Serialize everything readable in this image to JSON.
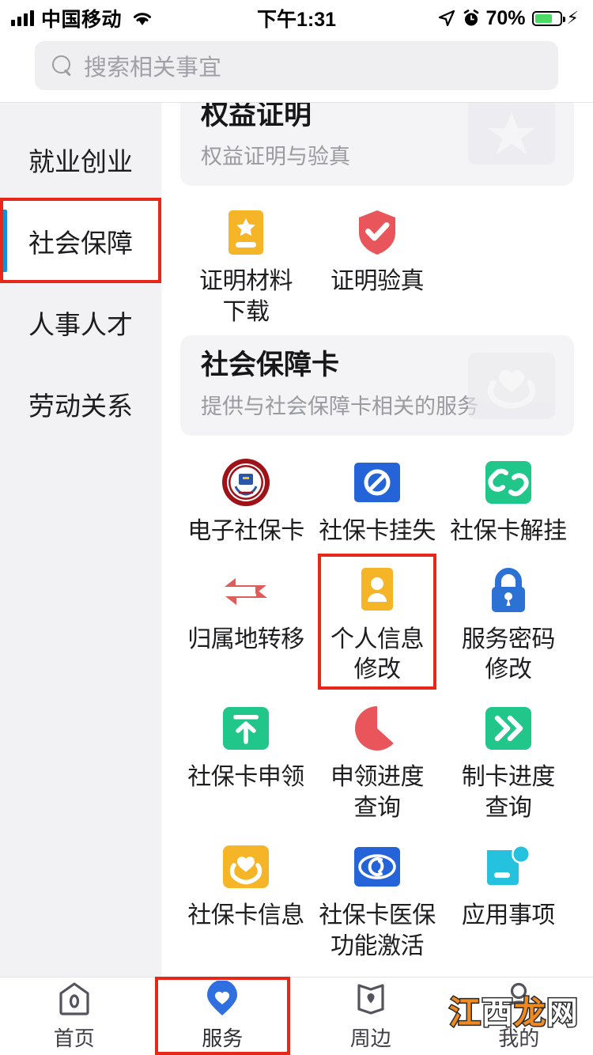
{
  "status_bar": {
    "carrier": "中国移动",
    "time": "下午1:31",
    "battery_percent": "70%",
    "signal_icon": "signal-bars-icon",
    "wifi_icon": "wifi-icon",
    "location_icon": "location-arrow-icon",
    "alarm_icon": "alarm-clock-icon",
    "battery_icon": "battery-icon",
    "charging_icon": "charging-bolt-icon",
    "battery_fill_color": "#4CD964"
  },
  "search": {
    "placeholder": "搜索相关事宜",
    "icon": "search-icon"
  },
  "sidebar": {
    "items": [
      {
        "label": "就业创业",
        "active": false
      },
      {
        "label": "社会保障",
        "active": true
      },
      {
        "label": "人事人才",
        "active": false
      },
      {
        "label": "劳动关系",
        "active": false
      }
    ],
    "active_indicator_color": "#1A8FD1"
  },
  "annotations": {
    "color": "#E8271B",
    "targets": [
      "sidebar-item-社会保障",
      "个人信息修改",
      "服务-tab"
    ]
  },
  "sections": [
    {
      "title": "权益证明",
      "subtitle": "权益证明与验真",
      "watermark_icon": "star-watermark-icon",
      "clipped": true,
      "items": [
        {
          "label": "证明材料\n下载",
          "label_lines": [
            "证明材料",
            "下载"
          ],
          "icon": "certificate-star-icon",
          "color": "#F5B526"
        },
        {
          "label": "证明验真",
          "label_lines": [
            "证明验真"
          ],
          "icon": "shield-check-icon",
          "color": "#E8555A"
        }
      ]
    },
    {
      "title": "社会保障卡",
      "subtitle": "提供与社会保障卡相关的服务",
      "watermark_icon": "heart-hands-watermark-icon",
      "clipped": false,
      "items": [
        {
          "label": "电子社保卡",
          "label_lines": [
            "电子社保卡"
          ],
          "icon": "social-security-card-emblem-icon",
          "color": "#A8171B"
        },
        {
          "label": "社保卡挂失",
          "label_lines": [
            "社保卡挂失"
          ],
          "icon": "prohibition-icon",
          "color": "#2563D9"
        },
        {
          "label": "社保卡解挂",
          "label_lines": [
            "社保卡解挂"
          ],
          "icon": "broken-link-icon",
          "color": "#21C68A"
        },
        {
          "label": "归属地转移",
          "label_lines": [
            "归属地转移"
          ],
          "icon": "two-way-arrows-icon",
          "color": "#E05B5B"
        },
        {
          "label": "个人信息修改",
          "label_lines": [
            "个人信息",
            "修改"
          ],
          "icon": "id-card-person-icon",
          "color": "#F5B526",
          "highlighted": true
        },
        {
          "label": "服务密码修改",
          "label_lines": [
            "服务密码",
            "修改"
          ],
          "icon": "padlock-icon",
          "color": "#2B72D4"
        },
        {
          "label": "社保卡申领",
          "label_lines": [
            "社保卡申领"
          ],
          "icon": "upload-arrow-icon",
          "color": "#21C68A"
        },
        {
          "label": "申领进度查询",
          "label_lines": [
            "申领进度",
            "查询"
          ],
          "icon": "pie-progress-icon",
          "color": "#E8555A"
        },
        {
          "label": "制卡进度查询",
          "label_lines": [
            "制卡进度",
            "查询"
          ],
          "icon": "double-chevron-icon",
          "color": "#21C68A"
        },
        {
          "label": "社保卡信息",
          "label_lines": [
            "社保卡信息"
          ],
          "icon": "heart-hands-icon",
          "color": "#F5B526"
        },
        {
          "label": "社保卡医保功能激活",
          "label_lines": [
            "社保卡医保",
            "功能激活"
          ],
          "icon": "si-logo-icon",
          "color": "#2563D9"
        },
        {
          "label": "应用事项",
          "label_lines": [
            "应用事项"
          ],
          "icon": "app-card-icon",
          "color": "#25C2E0"
        }
      ]
    }
  ],
  "tabbar": {
    "items": [
      {
        "label": "首页",
        "icon": "home-icon",
        "active": false
      },
      {
        "label": "服务",
        "icon": "heart-pin-icon",
        "active": true
      },
      {
        "label": "周边",
        "icon": "map-pin-icon",
        "active": false
      },
      {
        "label": "我的",
        "icon": "person-icon",
        "active": false
      }
    ],
    "active_color": "#2F6FE0",
    "inactive_color": "#54545C"
  },
  "watermark": {
    "text": "江西龙网",
    "chars": [
      "江",
      "西",
      "龙",
      "网"
    ]
  }
}
